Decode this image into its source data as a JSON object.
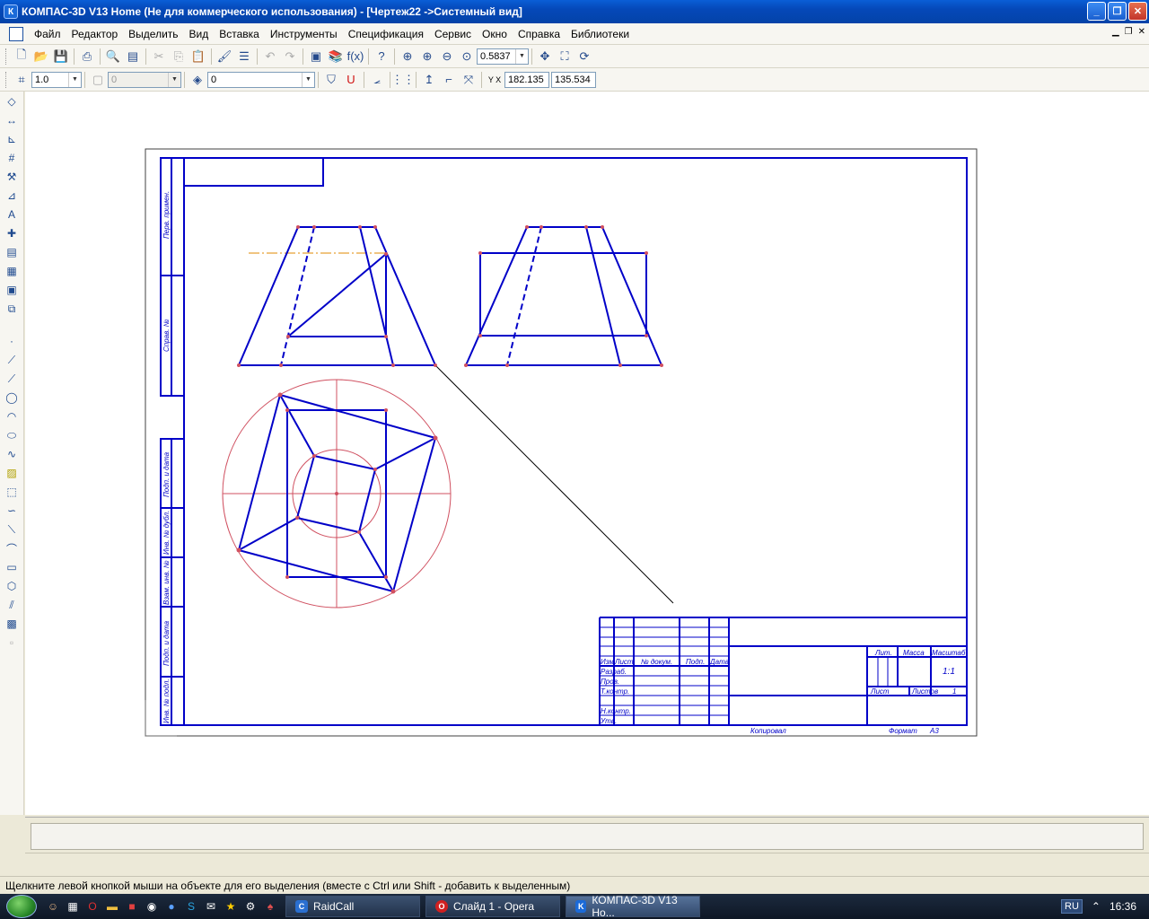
{
  "window": {
    "title": "КОМПАС-3D V13 Home (Не для коммерческого использования) - [Чертеж22 ->Системный вид]",
    "app_icon": "К"
  },
  "menu": [
    "Файл",
    "Редактор",
    "Выделить",
    "Вид",
    "Вставка",
    "Инструменты",
    "Спецификация",
    "Сервис",
    "Окно",
    "Справка",
    "Библиотеки"
  ],
  "toolbar1": {
    "zoom_value": "0.5837"
  },
  "toolbar2": {
    "line_scale": "1.0",
    "style_value": "0",
    "layer_value": "0",
    "coord_x": "182.135",
    "coord_y": "135.534",
    "coord_label": "Y X"
  },
  "drawing": {
    "side_labels": [
      "Перв. примен.",
      "Справ. №",
      "Подп. и дата",
      "Инв. № дубл.",
      "Взам. инв. №",
      "Подп. и дата",
      "Инв. № подл."
    ],
    "title_block": {
      "row_labels": [
        "Изм.",
        "Лист",
        "№ докум.",
        "Подп.",
        "Дата"
      ],
      "roles": [
        "Разраб.",
        "Пров.",
        "Т.контр.",
        "Н.контр.",
        "Утв."
      ],
      "lit": "Лит.",
      "mass": "Масса",
      "scale": "Масштаб",
      "scale_value": "1:1",
      "sheet": "Лист",
      "sheets": "Листов",
      "sheets_value": "1",
      "copied": "Копировал",
      "format": "Формат",
      "format_value": "A3"
    }
  },
  "status": {
    "hint": "Щелкните левой кнопкой мыши на объекте для его выделения (вместе с Ctrl или Shift - добавить к выделенным)"
  },
  "taskbar": {
    "tasks": [
      {
        "label": "RaidCall",
        "icon": "raidcall-icon"
      },
      {
        "label": "Слайд 1 - Opera",
        "icon": "opera-icon"
      },
      {
        "label": "КОМПАС-3D V13 Но...",
        "icon": "kompas-icon"
      }
    ],
    "lang": "RU",
    "time": "16:36"
  },
  "colors": {
    "drawing_line": "#0000c8",
    "construction": "#d05060",
    "axis": "#e08a00"
  }
}
